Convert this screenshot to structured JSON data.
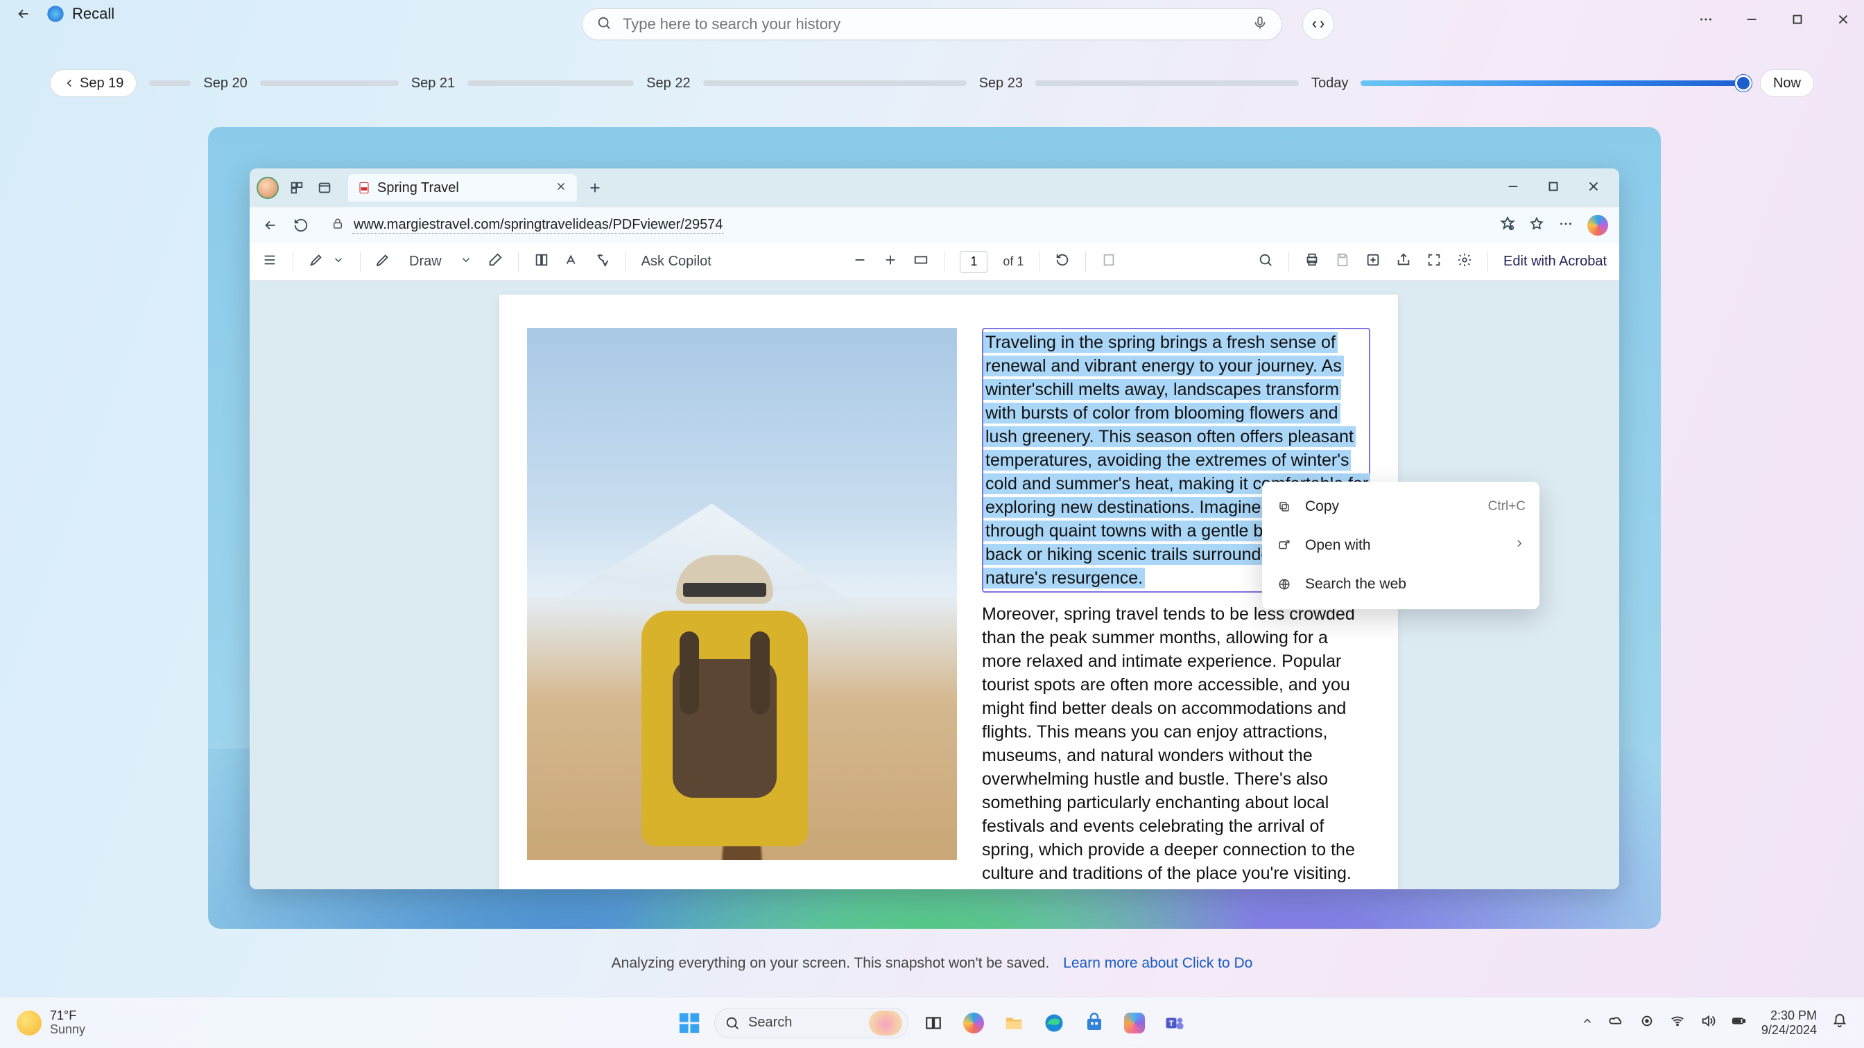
{
  "recall": {
    "title": "Recall",
    "search_placeholder": "Type here to search your history"
  },
  "timeline": {
    "dates": [
      "Sep 19",
      "Sep 20",
      "Sep 21",
      "Sep 22",
      "Sep 23"
    ],
    "today_label": "Today",
    "now_label": "Now"
  },
  "browser": {
    "tab_title": "Spring Travel",
    "url": "www.margiestravel.com/springtravelideas/PDFviewer/29574"
  },
  "pdfbar": {
    "draw": "Draw",
    "ask_copilot": "Ask Copilot",
    "page_current": "1",
    "page_of": "of 1",
    "edit_acrobat": "Edit with Acrobat"
  },
  "doc": {
    "highlighted": "Traveling in the spring brings a fresh sense of renewal and vibrant energy to your journey. As winter'schill melts away, landscapes transform with bursts of color from blooming flowers and lush greenery. This season often offers pleasant temperatures, avoiding the extremes of winter's cold and summer's heat, making it comfortable for exploring new destinations. Imagine strolling through quaint towns with a gentle breeze at your back or hiking scenic trails surrounded by nature's resurgence.",
    "para2": "Moreover, spring travel tends to be less crowded than the peak summer months, allowing for a more relaxed and intimate experience. Popular tourist spots are often more accessible, and you might find better deals on accommodations and flights. This means you can enjoy attractions, museums, and natural wonders without the overwhelming hustle and bustle. There's also something particularly enchanting about local festivals and events celebrating the arrival of spring, which provide a deeper connection to the culture and traditions of the place you're visiting."
  },
  "ctx": {
    "copy": "Copy",
    "copy_shortcut": "Ctrl+C",
    "open_with": "Open with",
    "search_web": "Search the web"
  },
  "status": {
    "text": "Analyzing everything on your screen. This snapshot won't be saved.",
    "link": "Learn more about Click to Do"
  },
  "taskbar": {
    "temp": "71°F",
    "cond": "Sunny",
    "search": "Search",
    "time": "2:30 PM",
    "date": "9/24/2024"
  }
}
